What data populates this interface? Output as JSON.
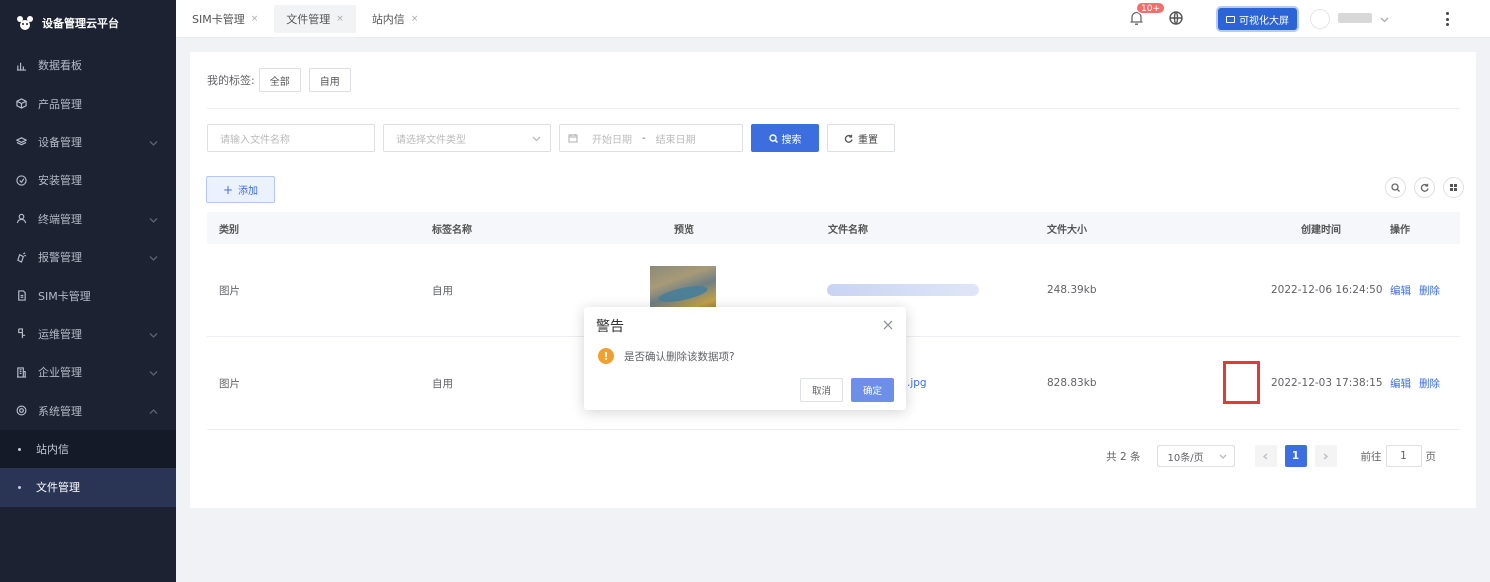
{
  "app": {
    "title": "设备管理云平台"
  },
  "sidebar": {
    "items": [
      {
        "label": "数据看板",
        "icon": "bar-chart-icon",
        "has_children": false
      },
      {
        "label": "产品管理",
        "icon": "cube-icon",
        "has_children": false
      },
      {
        "label": "设备管理",
        "icon": "layers-icon",
        "has_children": true
      },
      {
        "label": "安装管理",
        "icon": "tool-icon",
        "has_children": false
      },
      {
        "label": "终端管理",
        "icon": "user-icon",
        "has_children": true
      },
      {
        "label": "报警管理",
        "icon": "alarm-icon",
        "has_children": true
      },
      {
        "label": "SIM卡管理",
        "icon": "sim-card-icon",
        "has_children": false
      },
      {
        "label": "运维管理",
        "icon": "server-icon",
        "has_children": true
      },
      {
        "label": "企业管理",
        "icon": "building-icon",
        "has_children": true
      },
      {
        "label": "系统管理",
        "icon": "settings-icon",
        "has_children": true,
        "expanded": true
      }
    ],
    "sub_items": [
      {
        "label": "站内信",
        "active": false
      },
      {
        "label": "文件管理",
        "active": true
      }
    ]
  },
  "header": {
    "tabs": [
      {
        "label": "SIM卡管理",
        "active": false
      },
      {
        "label": "文件管理",
        "active": true
      },
      {
        "label": "站内信",
        "active": false
      }
    ],
    "notification_badge": "10+",
    "big_screen_label": "可视化大屏"
  },
  "filters": {
    "my_tags_label": "我的标签:",
    "tags": [
      "全部",
      "自用"
    ],
    "file_name_placeholder": "请输入文件名称",
    "file_type_placeholder": "请选择文件类型",
    "start_date_placeholder": "开始日期",
    "date_separator": "-",
    "end_date_placeholder": "结束日期",
    "search_label": "搜索",
    "reset_label": "重置"
  },
  "toolbar": {
    "add_label": "添加"
  },
  "table": {
    "columns": [
      "类别",
      "标签名称",
      "预览",
      "文件名称",
      "文件大小",
      "创建时间",
      "操作"
    ],
    "rows": [
      {
        "type": "图片",
        "tag": "自用",
        "file_suffix": "",
        "size": "248.39kb",
        "created": "2022-12-06 16:24:50",
        "edit": "编辑",
        "delete": "删除"
      },
      {
        "type": "图片",
        "tag": "自用",
        "file_suffix": ".jpg",
        "size": "828.83kb",
        "created": "2022-12-03 17:38:15",
        "edit": "编辑",
        "delete": "删除"
      }
    ]
  },
  "pagination": {
    "total": "共 2 条",
    "page_size": "10条/页",
    "current_page": "1",
    "goto_prefix": "前往",
    "goto_value": "1",
    "goto_suffix": "页"
  },
  "dialog": {
    "title": "警告",
    "message": "是否确认删除该数据项?",
    "cancel_label": "取消",
    "confirm_label": "确定"
  },
  "colors": {
    "primary": "#3c6ee0",
    "sidebar_bg": "#1d2233",
    "warning": "#f0a030",
    "highlight": "#e53935"
  }
}
